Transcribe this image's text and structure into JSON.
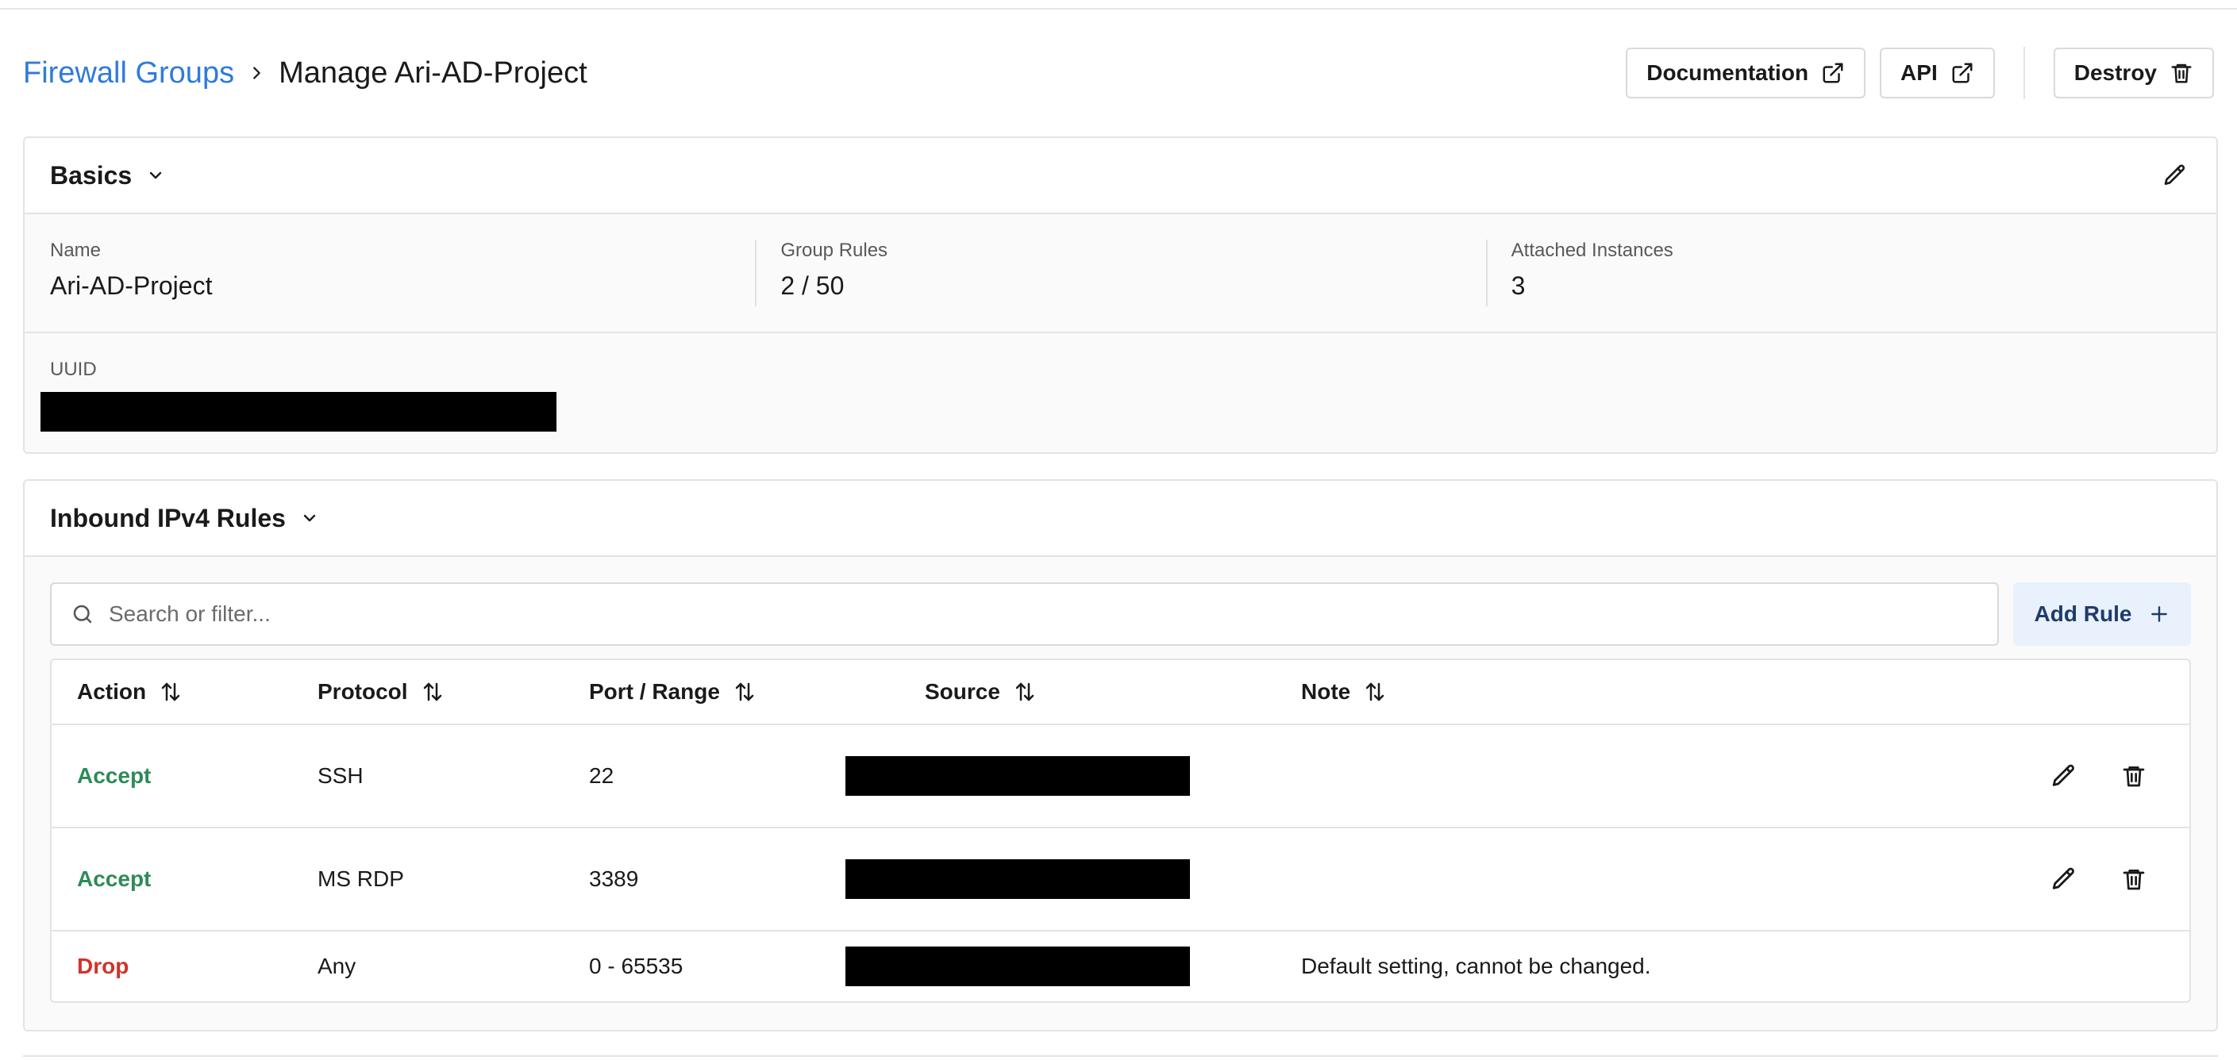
{
  "breadcrumb": {
    "parent": "Firewall Groups",
    "current": "Manage Ari-AD-Project"
  },
  "header_actions": {
    "documentation": "Documentation",
    "api": "API",
    "destroy": "Destroy"
  },
  "basics": {
    "title": "Basics",
    "fields": [
      {
        "label": "Name",
        "value": "Ari-AD-Project"
      },
      {
        "label": "Group Rules",
        "value": "2 / 50"
      },
      {
        "label": "Attached Instances",
        "value": "3"
      }
    ],
    "uuid_label": "UUID"
  },
  "rules": {
    "title": "Inbound IPv4 Rules",
    "search_placeholder": "Search or filter...",
    "add_rule": "Add Rule",
    "columns": [
      "Action",
      "Protocol",
      "Port / Range",
      "Source",
      "Note"
    ],
    "rows": [
      {
        "action": "Accept",
        "protocol": "SSH",
        "port": "22",
        "note": "",
        "editable": true
      },
      {
        "action": "Accept",
        "protocol": "MS RDP",
        "port": "3389",
        "note": "",
        "editable": true
      },
      {
        "action": "Drop",
        "protocol": "Any",
        "port": "0 - 65535",
        "note": "Default setting, cannot be changed.",
        "editable": false
      }
    ]
  },
  "colors": {
    "link": "#2f7bd9",
    "accept": "#2e8b57",
    "drop": "#d0342c",
    "add_button_bg": "#e8f1fc"
  },
  "icons": {
    "breadcrumb_separator": "chevron-right-icon",
    "external_link": "external-link-icon",
    "destroy": "trash-icon",
    "collapse": "chevron-down-icon",
    "edit": "pencil-icon",
    "search": "search-icon",
    "add": "plus-icon",
    "sort": "sort-arrows-icon"
  }
}
